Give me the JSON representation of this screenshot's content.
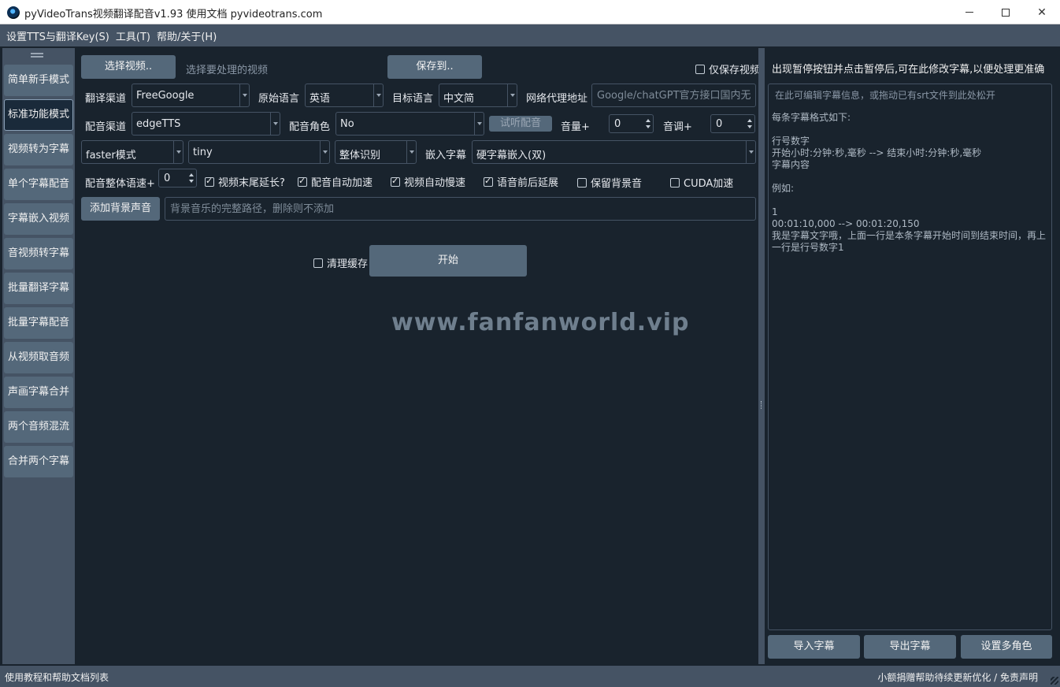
{
  "window": {
    "title": "pyVideoTrans视频翻译配音v1.93   使用文档   pyvideotrans.com"
  },
  "menubar": [
    "设置TTS与翻译Key(S)",
    "工具(T)",
    "帮助/关于(H)"
  ],
  "sidebar": {
    "items": [
      {
        "label": "简单新手模式",
        "active": false
      },
      {
        "label": "标准功能模式",
        "active": true
      },
      {
        "label": "视频转为字幕",
        "active": false
      },
      {
        "label": "单个字幕配音",
        "active": false
      },
      {
        "label": "字幕嵌入视频",
        "active": false
      },
      {
        "label": "音视频转字幕",
        "active": false
      },
      {
        "label": "批量翻译字幕",
        "active": false
      },
      {
        "label": "批量字幕配音",
        "active": false
      },
      {
        "label": "从视频取音频",
        "active": false
      },
      {
        "label": "声画字幕合并",
        "active": false
      },
      {
        "label": "两个音频混流",
        "active": false
      },
      {
        "label": "合并两个字幕",
        "active": false
      }
    ]
  },
  "row1": {
    "select_video_btn": "选择视频..",
    "select_video_hint": "选择要处理的视频",
    "save_to_btn": "保存到..",
    "only_video_label": "仅保存视频",
    "only_video_checked": false
  },
  "row2": {
    "translate_channel_label": "翻译渠道",
    "translate_channel_value": "FreeGoogle",
    "source_lang_label": "原始语言",
    "source_lang_value": "英语",
    "target_lang_label": "目标语言",
    "target_lang_value": "中文简",
    "proxy_label": "网络代理地址",
    "proxy_placeholder": "Google/chatGPT官方接口国内无..."
  },
  "row3": {
    "tts_channel_label": "配音渠道",
    "tts_channel_value": "edgeTTS",
    "voice_role_label": "配音角色",
    "voice_role_value": "No",
    "listen_btn": "试听配音",
    "volume_label": "音量+",
    "volume_value": "0",
    "pitch_label": "音调+",
    "pitch_value": "0"
  },
  "row4": {
    "model_mode_value": "faster模式",
    "model_size_value": "tiny",
    "recognize_mode_value": "整体识别",
    "embed_sub_label": "嵌入字幕",
    "embed_sub_value": "硬字幕嵌入(双)"
  },
  "row5": {
    "speed_label": "配音整体语速+",
    "speed_value": "0",
    "checks": [
      {
        "label": "视频末尾延长?",
        "checked": true
      },
      {
        "label": "配音自动加速",
        "checked": true
      },
      {
        "label": "视频自动慢速",
        "checked": true
      },
      {
        "label": "语音前后延展",
        "checked": true
      },
      {
        "label": "保留背景音",
        "checked": false
      },
      {
        "label": "CUDA加速",
        "checked": false
      }
    ]
  },
  "row6": {
    "add_bg_btn": "添加背景声音",
    "bg_placeholder": "背景音乐的完整路径，删除则不添加"
  },
  "actions": {
    "clear_cache_label": "清理缓存",
    "clear_cache_checked": false,
    "start_btn": "开始"
  },
  "watermark": "www.fanfanworld.vip",
  "right_panel": {
    "heading": "出现暂停按钮并点击暂停后,可在此修改字幕,以便处理更准确",
    "placeholder": "在此可编辑字幕信息，或拖动已有srt文件到此处松开",
    "lines": [
      "每条字幕格式如下:",
      "",
      "行号数字",
      "开始小时:分钟:秒,毫秒 --> 结束小时:分钟:秒,毫秒",
      "字幕内容",
      "",
      "例如:",
      "",
      "1",
      "00:01:10,000 --> 00:01:20,150",
      "我是字幕文字哦，上面一行是本条字幕开始时间到结束时间，再上一行是行号数字1"
    ],
    "import_btn": "导入字幕",
    "export_btn": "导出字幕",
    "multi_role_btn": "设置多角色"
  },
  "statusbar": {
    "left": "使用教程和帮助文档列表",
    "right": "小额捐赠帮助待续更新优化 / 免责声明"
  }
}
